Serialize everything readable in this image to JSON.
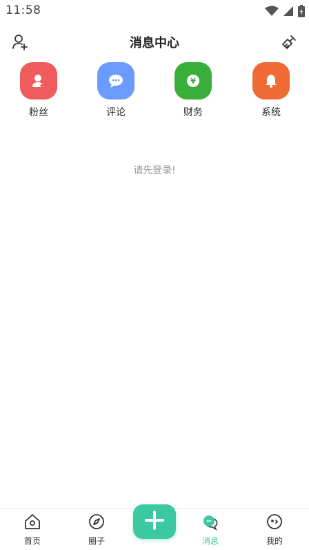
{
  "status_bar": {
    "time": "11:58"
  },
  "header": {
    "title": "消息中心"
  },
  "categories": [
    {
      "label": "粉丝",
      "icon": "fans-icon",
      "color": "#f05b5b"
    },
    {
      "label": "评论",
      "icon": "comment-icon",
      "color": "#6c9bff"
    },
    {
      "label": "财务",
      "icon": "finance-icon",
      "color": "#3aae3a"
    },
    {
      "label": "系统",
      "icon": "system-bell-icon",
      "color": "#f06a36"
    }
  ],
  "empty_message": "请先登录!",
  "bottom_nav": {
    "items": [
      {
        "label": "首页",
        "icon": "home-icon",
        "active": false
      },
      {
        "label": "圈子",
        "icon": "compass-icon",
        "active": false
      },
      {
        "label": "消息",
        "icon": "message-icon",
        "active": true
      },
      {
        "label": "我的",
        "icon": "profile-icon",
        "active": false
      }
    ],
    "accent": "#3cc8a0"
  }
}
